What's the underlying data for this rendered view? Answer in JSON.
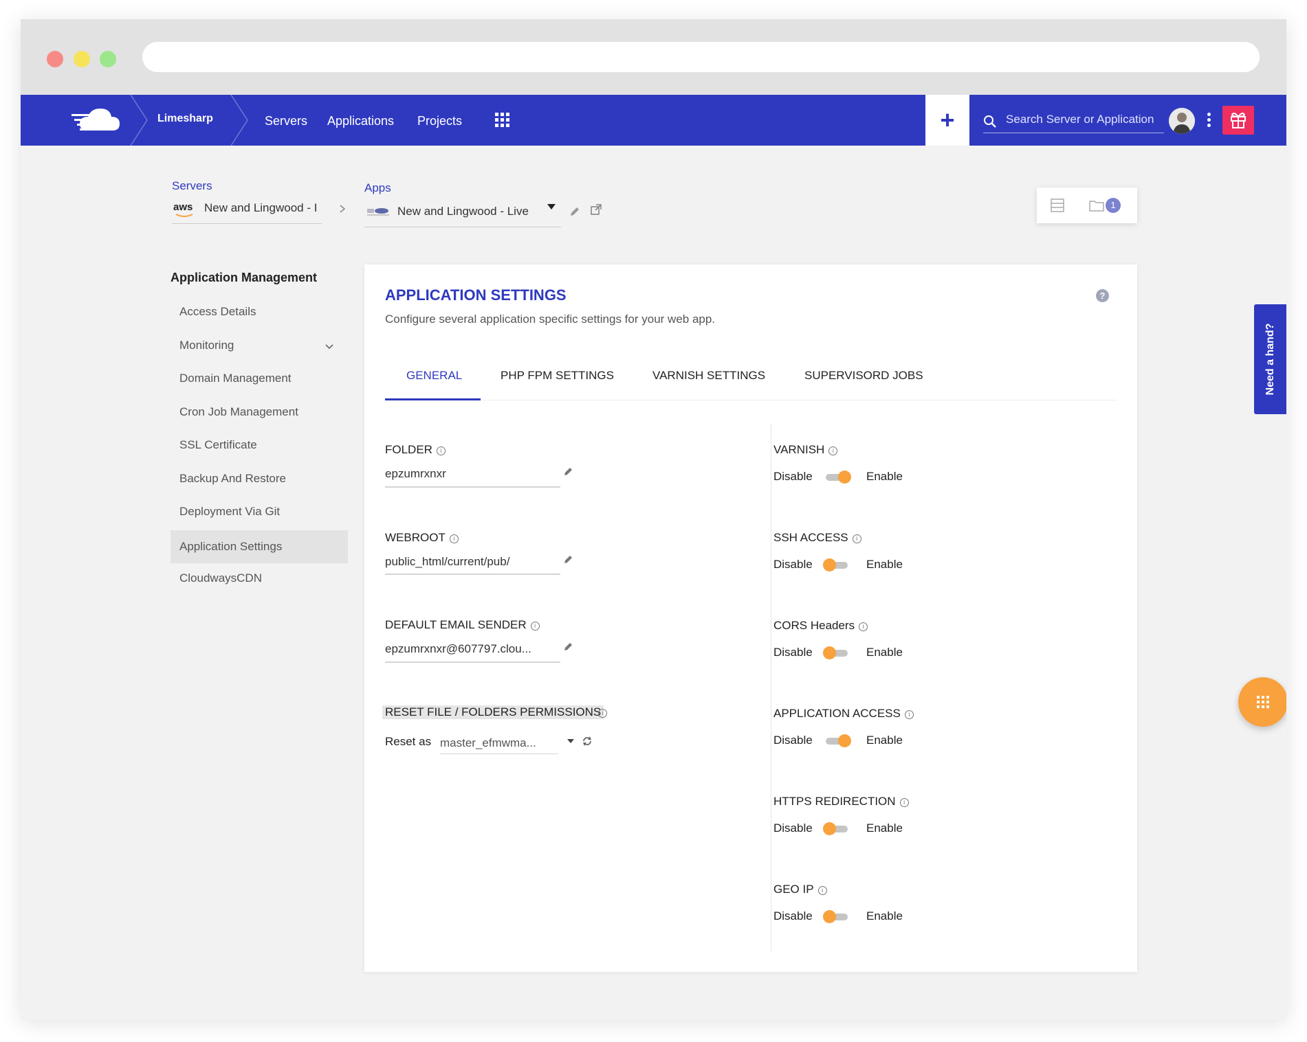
{
  "nav": {
    "brand": "Limesharp",
    "links": [
      "Servers",
      "Applications",
      "Projects"
    ],
    "search_placeholder": "Search Server or Application"
  },
  "breadcrumb": {
    "servers_label": "Servers",
    "server_value": "New and Lingwood - I",
    "server_provider": "aws",
    "apps_label": "Apps",
    "app_value": "New and Lingwood - Live",
    "view_badge": "1"
  },
  "sidebar": {
    "title": "Application Management",
    "items": [
      "Access Details",
      "Monitoring",
      "Domain Management",
      "Cron Job Management",
      "SSL Certificate",
      "Backup And Restore",
      "Deployment Via Git",
      "Application Settings",
      "CloudwaysCDN"
    ],
    "active": "Application Settings"
  },
  "card": {
    "title": "APPLICATION SETTINGS",
    "subtitle": "Configure several application specific settings for your web app.",
    "help": "?",
    "tabs": [
      "GENERAL",
      "PHP FPM SETTINGS",
      "VARNISH SETTINGS",
      "SUPERVISORD JOBS"
    ],
    "active_tab": "GENERAL"
  },
  "fields": {
    "folder": {
      "label": "FOLDER",
      "value": "epzumrxnxr"
    },
    "webroot": {
      "label": "WEBROOT",
      "value": "public_html/current/pub/"
    },
    "email": {
      "label": "DEFAULT EMAIL SENDER",
      "value": "epzumrxnxr@607797.clou..."
    },
    "reset": {
      "label": "RESET FILE / FOLDERS PERMISSIONS",
      "reset_as_label": "Reset as",
      "reset_as_value": "master_efmwma..."
    }
  },
  "toggles": {
    "disable_label": "Disable",
    "enable_label": "Enable",
    "items": [
      {
        "label": "VARNISH",
        "enabled": true
      },
      {
        "label": "SSH ACCESS",
        "enabled": false
      },
      {
        "label": "CORS Headers",
        "enabled": false
      },
      {
        "label": "APPLICATION ACCESS",
        "enabled": true
      },
      {
        "label": "HTTPS REDIRECTION",
        "enabled": false
      },
      {
        "label": "GEO IP",
        "enabled": false
      }
    ]
  },
  "help_tab": "Need a hand?",
  "colors": {
    "primary": "#2f39bf",
    "accent": "#f8a13d",
    "gift": "#ee2f60"
  }
}
